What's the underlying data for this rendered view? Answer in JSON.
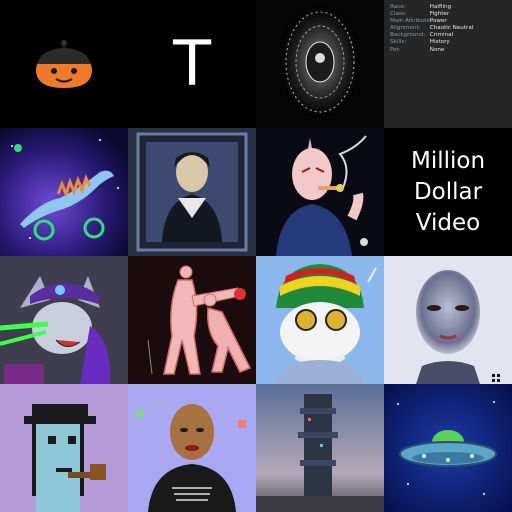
{
  "tiles": [
    {
      "name": "pumpkin-bot-nft",
      "label": ""
    },
    {
      "name": "letter-t-nft",
      "label": "T"
    },
    {
      "name": "dark-portal-nft",
      "label": ""
    },
    {
      "name": "character-traits-card",
      "label": ""
    },
    {
      "name": "space-lizard-nft",
      "label": ""
    },
    {
      "name": "framed-portrait-nft",
      "label": ""
    },
    {
      "name": "unicorn-smoker-nft",
      "label": ""
    },
    {
      "name": "million-dollar-video-card",
      "label": ""
    },
    {
      "name": "laser-cat-nft",
      "label": ""
    },
    {
      "name": "pink-figures-nft",
      "label": ""
    },
    {
      "name": "rasta-panda-nft",
      "label": ""
    },
    {
      "name": "silver-face-nft",
      "label": ""
    },
    {
      "name": "pixel-punk-pipe-nft",
      "label": ""
    },
    {
      "name": "bald-woman-nft",
      "label": ""
    },
    {
      "name": "cyber-tower-nft",
      "label": ""
    },
    {
      "name": "ufo-nft",
      "label": ""
    }
  ],
  "traits": [
    {
      "key": "Race:",
      "value": "Halfling"
    },
    {
      "key": "Class:",
      "value": "Fighter"
    },
    {
      "key": "Main Attribute:",
      "value": "Power"
    },
    {
      "key": "Alignment:",
      "value": "Chaotic Neutral"
    },
    {
      "key": "Background:",
      "value": "Criminal"
    },
    {
      "key": "Skills:",
      "value": "History"
    },
    {
      "key": "Pet:",
      "value": "None"
    }
  ],
  "million_dollar_video": [
    "Million",
    "Dollar",
    "Video"
  ],
  "colors": {
    "background": "#000000",
    "trait_key": "#8c93a0",
    "trait_value": "#e6e8ec"
  }
}
